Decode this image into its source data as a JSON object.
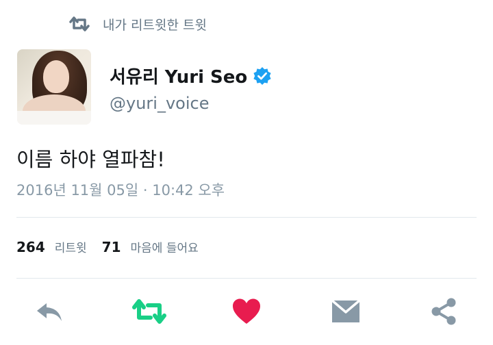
{
  "context": {
    "label": "내가 리트윗한 트윗",
    "icon": "retweet-icon"
  },
  "user": {
    "display_name": "서유리 Yuri Seo",
    "handle": "@yuri_voice",
    "verified": true
  },
  "tweet": {
    "text": "이름 하야 열파참!",
    "timestamp": "2016년 11월 05일 · 10:42 오후"
  },
  "stats": {
    "retweets": "264",
    "retweets_label": "리트윗",
    "likes": "71",
    "likes_label": "마음에 들어요"
  },
  "actions": [
    {
      "name": "reply-icon",
      "color": "#8899a6"
    },
    {
      "name": "retweet-icon",
      "color": "#19cf86",
      "active": true
    },
    {
      "name": "heart-icon",
      "color": "#e81c4f",
      "active": true
    },
    {
      "name": "message-icon",
      "color": "#8899a6"
    },
    {
      "name": "share-icon",
      "color": "#8899a6"
    }
  ],
  "colors": {
    "verified": "#1da1f2",
    "secondary_text": "#657786",
    "divider": "#e1e8ed"
  }
}
